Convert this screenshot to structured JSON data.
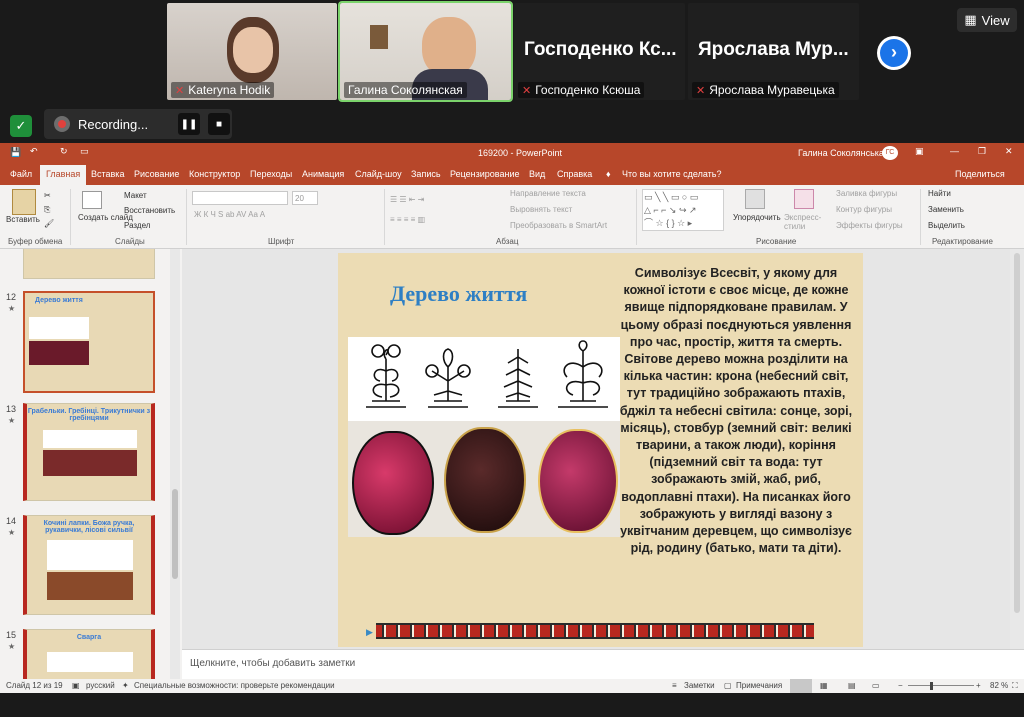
{
  "zoom": {
    "participants": [
      {
        "name": "Kateryna Hodik",
        "muted": true,
        "video": true
      },
      {
        "name": "Галина Соколянская",
        "muted": false,
        "video": true,
        "active": true
      },
      {
        "name": "Господенко Ксюша",
        "big_label": "Господенко Кс...",
        "muted": true,
        "video": false
      },
      {
        "name": "Ярослава Муравецька",
        "big_label": "Ярослава Мур...",
        "muted": true,
        "video": false
      }
    ],
    "view_label": "View",
    "recording_label": "Recording...",
    "next_icon": "chevron-right-icon"
  },
  "ppt": {
    "doc_title": "169200 - PowerPoint",
    "user_name": "Галина Соколянська",
    "user_initials": "ГС",
    "tabs": [
      "Файл",
      "Главная",
      "Вставка",
      "Рисование",
      "Конструктор",
      "Переходы",
      "Анимация",
      "Слайд-шоу",
      "Запись",
      "Рецензирование",
      "Вид",
      "Справка"
    ],
    "tell_me": "Что вы хотите сделать?",
    "share": "Поделиться",
    "ribbon": {
      "paste": "Вставить",
      "create_slide": "Создать слайд",
      "layout": "Макет",
      "reset": "Восстановить",
      "section": "Раздел",
      "font_size": "20",
      "text_direction": "Направление текста",
      "align_text": "Выровнять текст",
      "smartart": "Преобразовать в SmartArt",
      "arrange": "Упорядочить",
      "quick_styles": "Экспресс-стили",
      "shape_fill": "Заливка фигуры",
      "shape_outline": "Контур фигуры",
      "shape_effects": "Эффекты фигуры",
      "find": "Найти",
      "replace": "Заменить",
      "select": "Выделить",
      "groups": [
        "Буфер обмена",
        "Слайды",
        "Шрифт",
        "Абзац",
        "Рисование",
        "Редактирование"
      ]
    },
    "thumbnails": [
      {
        "num": "12",
        "title": "Дерево життя",
        "selected": true
      },
      {
        "num": "13",
        "title": "Грабельки. Гребінці. Трикутнички з гребінцями"
      },
      {
        "num": "14",
        "title": "Кочині лапки. Божа ручка, рукавички, лісові сильвії"
      },
      {
        "num": "15",
        "title": "Сварга"
      }
    ],
    "slide": {
      "title": "Дерево життя",
      "text": "Символізує Всесвіт, у якому для кожної істоти є своє місце, де кожне явище підпорядковане правилам. У цьому образі поєднуються уявлення про час, простір, життя та смерть. Світове дерево можна розділити на кілька частин: крона (небесний світ, тут традиційно зображають птахів, бджіл та небесні світила: сонце, зорі, місяць), стовбур (земний світ: великі тварини, а також люди), коріння (підземний світ та вода: тут зображають змій, жаб, риб, водоплавні птахи). На писанках його зображують у вигляді вазону з уквітчаним деревцем, що символізує рід, родину (батько, мати та діти)."
    },
    "notes_placeholder": "Щелкните, чтобы добавить заметки",
    "status": {
      "slide_info": "Слайд 12 из 19",
      "language": "русский",
      "accessibility": "Специальные возможности: проверьте рекомендации",
      "notes_btn": "Заметки",
      "comments_btn": "Примечания",
      "zoom": "82 %"
    }
  }
}
